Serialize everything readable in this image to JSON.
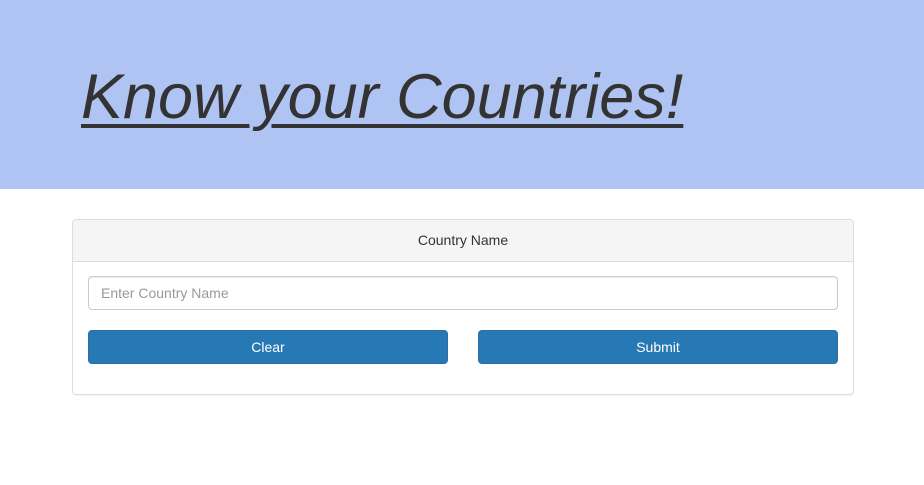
{
  "header": {
    "title": "Know your Countries!",
    "background_color": "#b0c4f3"
  },
  "panel": {
    "heading": "Country Name",
    "input": {
      "value": "",
      "placeholder": "Enter Country Name"
    },
    "buttons": {
      "clear_label": "Clear",
      "submit_label": "Submit",
      "color": "#2779b5"
    }
  }
}
